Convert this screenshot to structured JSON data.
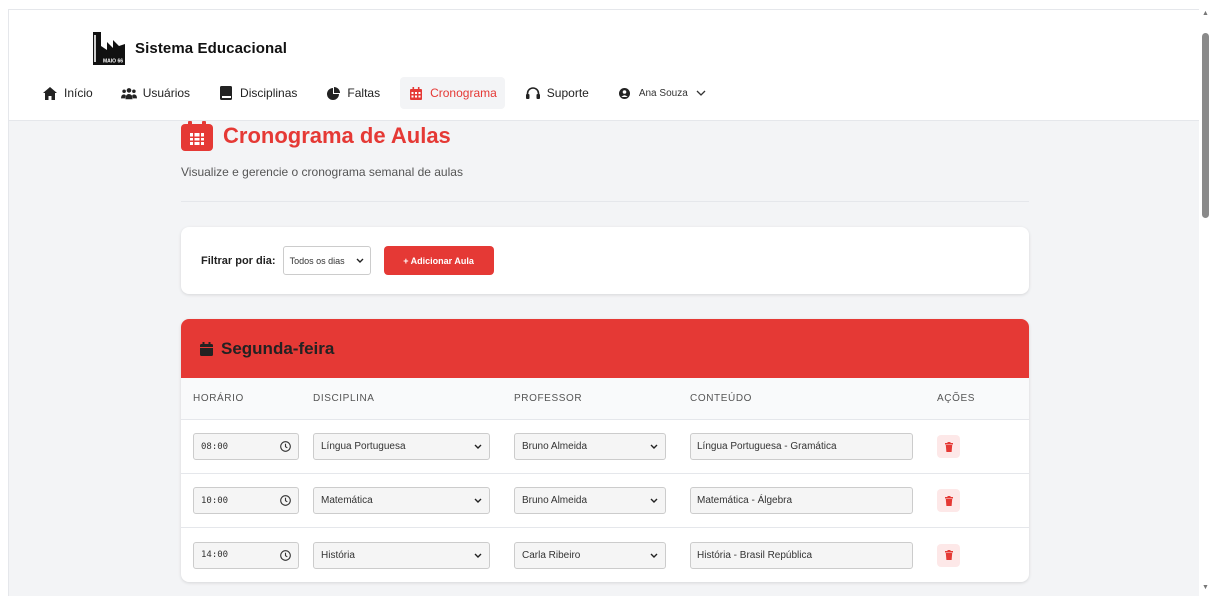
{
  "brand": {
    "name": "Sistema Educacional",
    "logo_text": "MAIO 66"
  },
  "nav": {
    "items": [
      {
        "label": "Início",
        "icon": "home-icon"
      },
      {
        "label": "Usuários",
        "icon": "users-icon"
      },
      {
        "label": "Disciplinas",
        "icon": "book-icon"
      },
      {
        "label": "Faltas",
        "icon": "pie-chart-icon"
      },
      {
        "label": "Cronograma",
        "icon": "calendar-icon"
      },
      {
        "label": "Suporte",
        "icon": "headset-icon"
      }
    ],
    "active": "Cronograma",
    "user": {
      "name": "Ana Souza",
      "icon": "user-circle-icon"
    }
  },
  "page": {
    "title": "Cronograma de Aulas",
    "subtitle": "Visualize e gerencie o cronograma semanal de aulas"
  },
  "filter": {
    "label": "Filtrar por dia:",
    "selected": "Todos os dias",
    "add_button": "+ Adicionar Aula"
  },
  "schedule": {
    "day": "Segunda-feira",
    "columns": [
      "HORÁRIO",
      "DISCIPLINA",
      "PROFESSOR",
      "CONTEÚDO",
      "AÇÕES"
    ],
    "rows": [
      {
        "time": "08:00",
        "disciplina": "Língua Portuguesa",
        "professor": "Bruno Almeida",
        "conteudo": "Língua Portuguesa - Gramática"
      },
      {
        "time": "10:00",
        "disciplina": "Matemática",
        "professor": "Bruno Almeida",
        "conteudo": "Matemática - Álgebra"
      },
      {
        "time": "14:00",
        "disciplina": "História",
        "professor": "Carla Ribeiro",
        "conteudo": "História - Brasil República"
      }
    ]
  },
  "colors": {
    "accent": "#e53935",
    "delete_bg": "#fde8e8"
  }
}
